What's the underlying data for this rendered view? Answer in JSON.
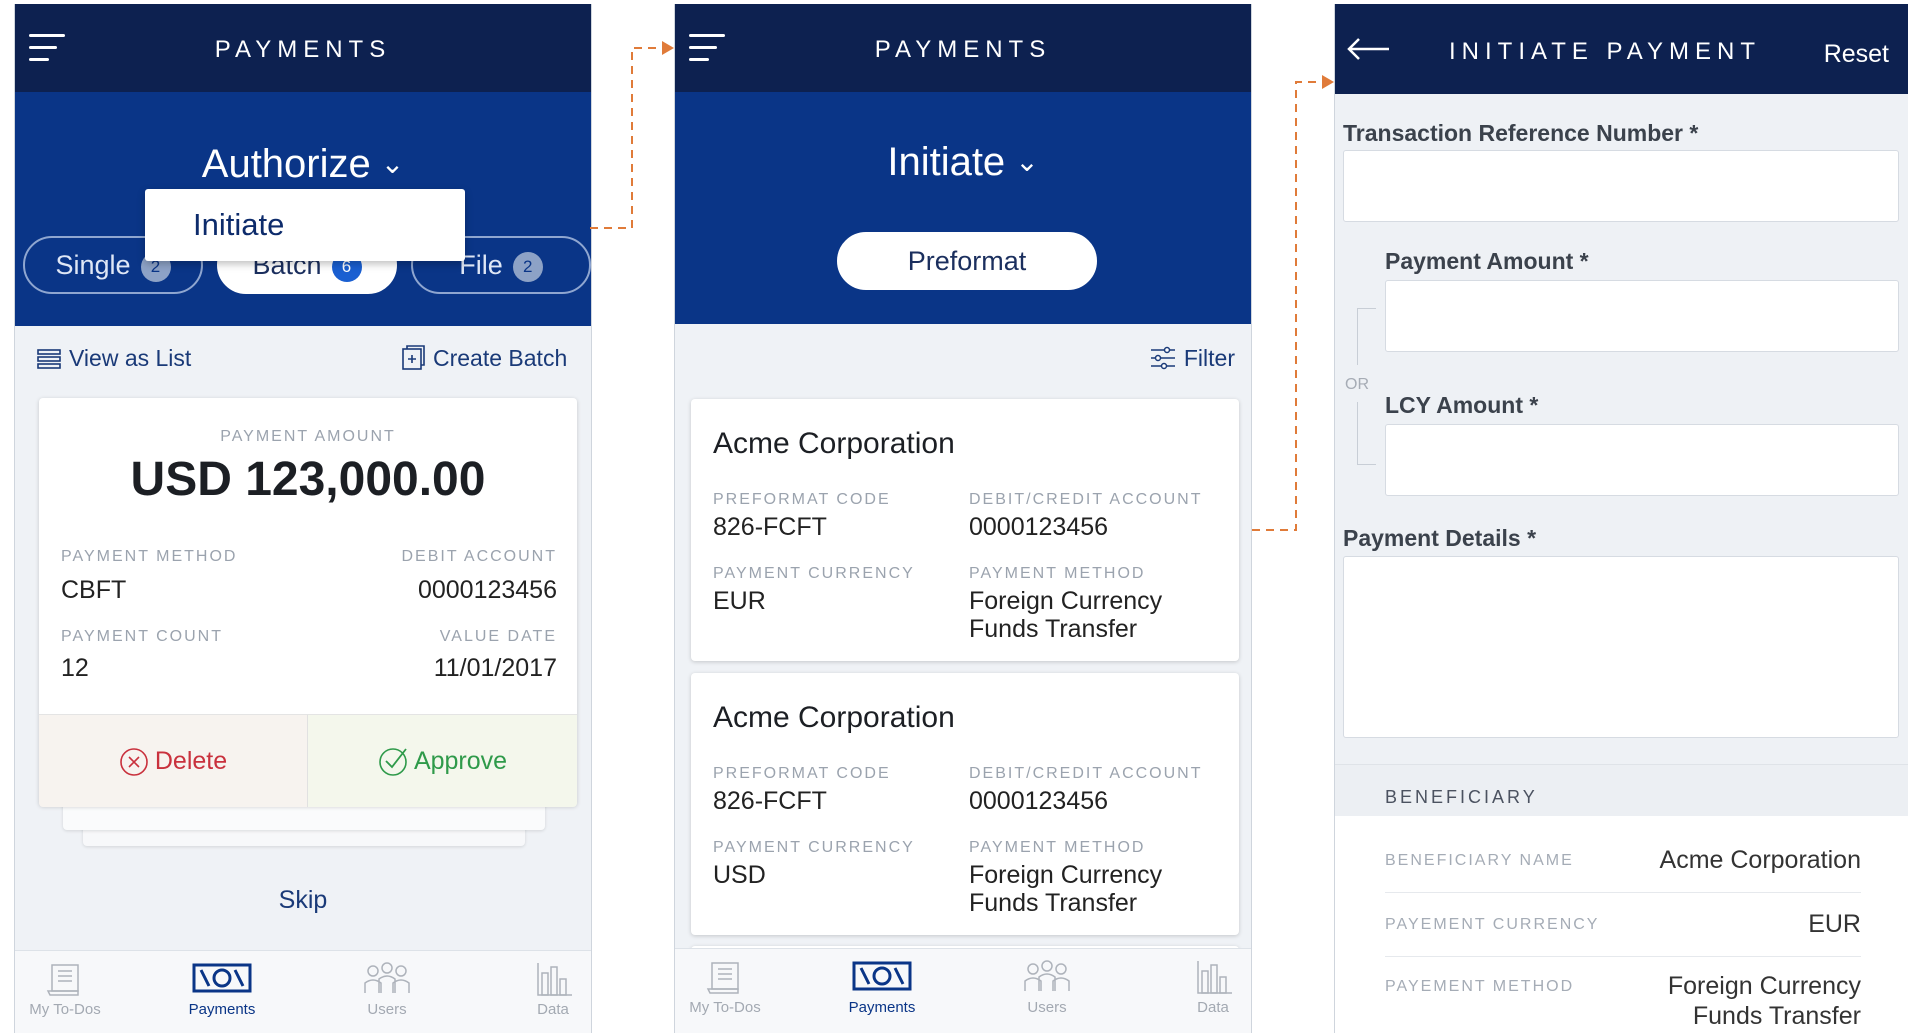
{
  "screen1": {
    "title": "PAYMENTS",
    "mode": "Authorize",
    "dropdown_item": "Initiate",
    "tabs": [
      {
        "label": "Single",
        "count": "2"
      },
      {
        "label": "Batch",
        "count": "6"
      },
      {
        "label": "File",
        "count": "2"
      }
    ],
    "view_list": "View as List",
    "create_batch": "Create Batch",
    "card": {
      "amount_label": "PAYMENT AMOUNT",
      "amount": "USD 123,000.00",
      "method_label": "PAYMENT METHOD",
      "method": "CBFT",
      "debit_label": "DEBIT ACCOUNT",
      "debit": "0000123456",
      "count_label": "PAYMENT COUNT",
      "count": "12",
      "value_date_label": "VALUE DATE",
      "value_date": "11/01/2017",
      "delete": "Delete",
      "approve": "Approve"
    },
    "skip": "Skip"
  },
  "screen2": {
    "title": "PAYMENTS",
    "mode": "Initiate",
    "preformat": "Preformat",
    "filter": "Filter",
    "cards": [
      {
        "company": "Acme Corporation",
        "code_label": "PREFORMAT CODE",
        "code": "826-FCFT",
        "account_label": "DEBIT/CREDIT ACCOUNT",
        "account": "0000123456",
        "currency_label": "PAYMENT CURRENCY",
        "currency": "EUR",
        "method_label": "PAYMENT METHOD",
        "method_line1": "Foreign Currency",
        "method_line2": "Funds Transfer"
      },
      {
        "company": "Acme Corporation",
        "code_label": "PREFORMAT CODE",
        "code": "826-FCFT",
        "account_label": "DEBIT/CREDIT ACCOUNT",
        "account": "0000123456",
        "currency_label": "PAYMENT CURRENCY",
        "currency": "USD",
        "method_label": "PAYMENT METHOD",
        "method_line1": "Foreign Currency",
        "method_line2": "Funds Transfer"
      }
    ]
  },
  "screen3": {
    "title": "INITIATE PAYMENT",
    "reset": "Reset",
    "fields": {
      "ref_label": "Transaction Reference Number *",
      "amount_label": "Payment Amount *",
      "or": "OR",
      "lcy_label": "LCY Amount *",
      "details_label": "Payment Details *"
    },
    "beneficiary": {
      "header": "BENEFICIARY",
      "name_label": "BENEFICIARY NAME",
      "name": "Acme Corporation",
      "currency_label": "PAYEMENT CURRENCY",
      "currency": "EUR",
      "method_label": "PAYEMENT METHOD",
      "method_line1": "Foreign Currency",
      "method_line2": "Funds Transfer"
    }
  },
  "nav": [
    "My To-Dos",
    "Payments",
    "Users",
    "Data"
  ],
  "colors": {
    "navy": "#0d2150",
    "blue": "#0a3587",
    "accent_arrow": "#e07b39",
    "delete": "#c9313d",
    "approve": "#2f9a4a"
  }
}
